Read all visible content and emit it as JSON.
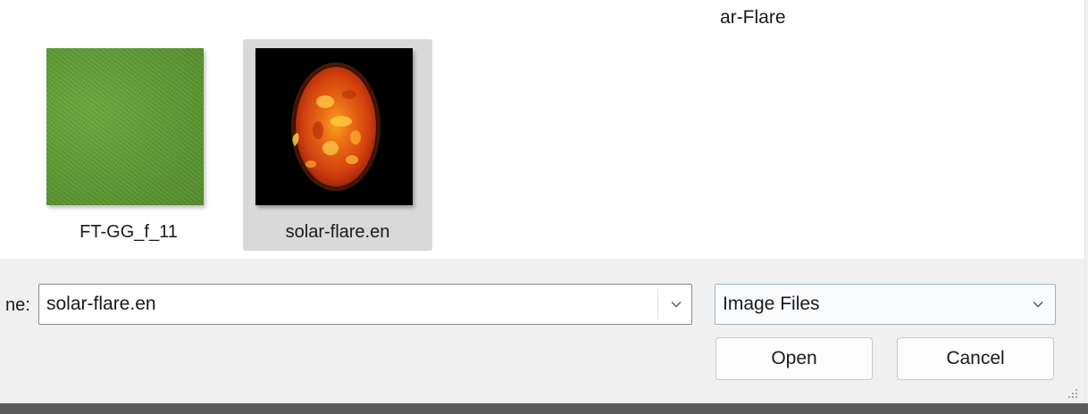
{
  "window": {
    "partial_title": "ar-Flare"
  },
  "files": [
    {
      "label": "FT-GG_f_11",
      "thumbnail": "green-grass-texture",
      "selected": false
    },
    {
      "label": "solar-flare.en",
      "thumbnail": "solar-flare-sun-image",
      "selected": true
    }
  ],
  "footer": {
    "filename_label": "ne:",
    "filename_value": "solar-flare.en",
    "filetype_value": "Image Files",
    "open_label": "Open",
    "cancel_label": "Cancel"
  },
  "icons": {
    "dropdown": "chevron-down-icon",
    "resize": "resize-grip-icon"
  },
  "colors": {
    "selection": "#d9d9d9",
    "panel": "#f0f0f0",
    "grass": "#5a9a2d",
    "sun_core": "#e8561a"
  }
}
